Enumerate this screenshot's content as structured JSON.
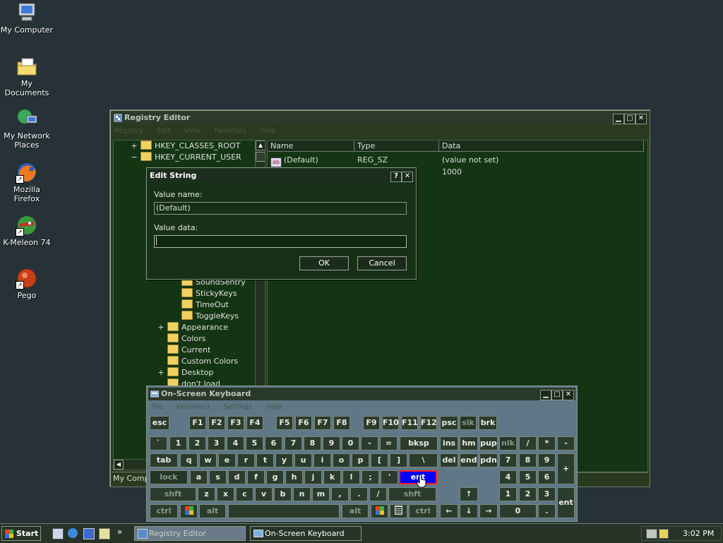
{
  "desktop": {
    "icons": [
      {
        "label": "My Computer"
      },
      {
        "label": "My Documents"
      },
      {
        "label": "My Network Places"
      },
      {
        "label": "Mozilla Firefox"
      },
      {
        "label": "K-Meleon 74"
      },
      {
        "label": "Pego"
      }
    ]
  },
  "registry": {
    "title": "Registry Editor",
    "menu": [
      "Registry",
      "Edit",
      "View",
      "Favorites",
      "Help"
    ],
    "tree": [
      {
        "expander": "+",
        "label": "HKEY_CLASSES_ROOT"
      },
      {
        "expander": "−",
        "label": "HKEY_CURRENT_USER"
      },
      {
        "expander": "",
        "label": "SoundSentry"
      },
      {
        "expander": "",
        "label": "StickyKeys"
      },
      {
        "expander": "",
        "label": "TimeOut"
      },
      {
        "expander": "",
        "label": "ToggleKeys"
      },
      {
        "expander": "+",
        "label": "Appearance"
      },
      {
        "expander": "",
        "label": "Colors"
      },
      {
        "expander": "",
        "label": "Current"
      },
      {
        "expander": "",
        "label": "Custom Colors"
      },
      {
        "expander": "+",
        "label": "Desktop"
      },
      {
        "expander": "",
        "label": "don't load"
      }
    ],
    "columns": {
      "name": "Name",
      "type": "Type",
      "data": "Data"
    },
    "rows": [
      {
        "name": "(Default)",
        "type": "REG_SZ",
        "data": "(value not set)"
      },
      {
        "name": "",
        "type": "",
        "data": "1000"
      }
    ],
    "status": "My Compu"
  },
  "dialog": {
    "title": "Edit String",
    "help": "?",
    "close": "✕",
    "value_name_label": "Value name:",
    "value_name": "(Default)",
    "value_data_label": "Value data:",
    "value_data": "",
    "ok": "OK",
    "cancel": "Cancel"
  },
  "keyboard": {
    "title": "On-Screen Keyboard",
    "menu": [
      "File",
      "Keyboard",
      "Settings",
      "Help"
    ],
    "keys": {
      "esc": "esc",
      "f1": "F1",
      "f2": "F2",
      "f3": "F3",
      "f4": "F4",
      "f5": "F5",
      "f6": "F6",
      "f7": "F7",
      "f8": "F8",
      "f9": "F9",
      "f10": "F10",
      "f11": "F11",
      "f12": "F12",
      "psc": "psc",
      "slk": "slk",
      "brk": "brk",
      "grave": "`",
      "n1": "1",
      "n2": "2",
      "n3": "3",
      "n4": "4",
      "n5": "5",
      "n6": "6",
      "n7": "7",
      "n8": "8",
      "n9": "9",
      "n0": "0",
      "minus": "-",
      "equals": "=",
      "bksp": "bksp",
      "ins": "ins",
      "hm": "hm",
      "pup": "pup",
      "nlk": "nlk",
      "kdiv": "/",
      "kmul": "*",
      "ksub": "-",
      "tab": "tab",
      "q": "q",
      "w": "w",
      "e": "e",
      "r": "r",
      "t": "t",
      "y": "y",
      "u": "u",
      "i": "i",
      "o": "o",
      "p": "p",
      "lbr": "[",
      "rbr": "]",
      "bslash": "\\",
      "del": "del",
      "end": "end",
      "pdn": "pdn",
      "k7": "7",
      "k8": "8",
      "k9": "9",
      "kadd": "+",
      "lock": "lock",
      "a": "a",
      "s": "s",
      "d": "d",
      "f": "f",
      "g": "g",
      "h": "h",
      "j": "j",
      "k": "k",
      "l": "l",
      "semi": ";",
      "quote": "'",
      "ent": "ent",
      "k4": "4",
      "k5": "5",
      "k6": "6",
      "shft": "shft",
      "z": "z",
      "x": "x",
      "c": "c",
      "v": "v",
      "b": "b",
      "n": "n",
      "m": "m",
      "comma": ",",
      "period": ".",
      "slash": "/",
      "shft2": "shft",
      "up": "↑",
      "k1": "1",
      "k2": "2",
      "k3": "3",
      "kent": "ent",
      "ctrl": "ctrl",
      "alt": "alt",
      "alt2": "alt",
      "ctrl2": "ctrl",
      "left": "←",
      "down": "↓",
      "right": "→",
      "k0": "0",
      "kdot": "."
    }
  },
  "taskbar": {
    "start": "Start",
    "items": [
      "Registry Editor",
      "On-Screen Keyboard"
    ],
    "chevron": "»",
    "clock": "3:02 PM"
  }
}
